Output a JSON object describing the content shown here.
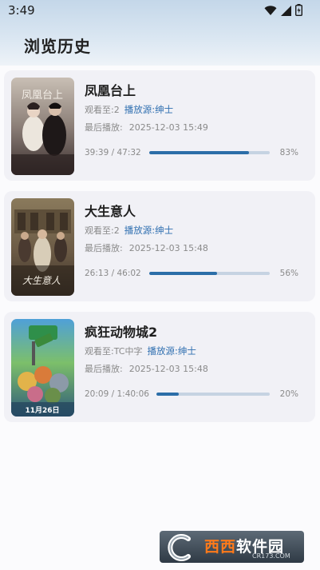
{
  "status_bar": {
    "time": "3:49",
    "icons": [
      "wifi-icon",
      "signal-icon",
      "battery-icon"
    ]
  },
  "page": {
    "title": "浏览历史"
  },
  "history": [
    {
      "title": "凤凰台上",
      "watched_prefix": "观看至:",
      "watched_value": "2",
      "source": "播放源:绅士",
      "last_label": "最后播放:",
      "last_time": "2025-12-03 15:49",
      "progress_text": "39:39 / 47:32",
      "progress": 0.83,
      "percent": "83%",
      "poster_caption": "凤凰台上"
    },
    {
      "title": "大生意人",
      "watched_prefix": "观看至:",
      "watched_value": "2",
      "source": "播放源:绅士",
      "last_label": "最后播放:",
      "last_time": "2025-12-03 15:48",
      "progress_text": "26:13 / 46:02",
      "progress": 0.56,
      "percent": "56%",
      "poster_caption": "大生意人"
    },
    {
      "title": "疯狂动物城2",
      "watched_prefix": "观看至:",
      "watched_value": "TC中字",
      "source": "播放源:绅士",
      "last_label": "最后播放:",
      "last_time": "2025-12-03 15:48",
      "progress_text": "20:09 / 1:40:06",
      "progress": 0.2,
      "percent": "20%",
      "poster_caption": "11月26日"
    }
  ],
  "colors": {
    "accent": "#2c6ea8",
    "source_link": "#2f6fb0",
    "track": "#c6d3e2"
  },
  "watermark": {
    "brand_a": "西西",
    "brand_b": "软件园",
    "url": "CR173.COM"
  }
}
